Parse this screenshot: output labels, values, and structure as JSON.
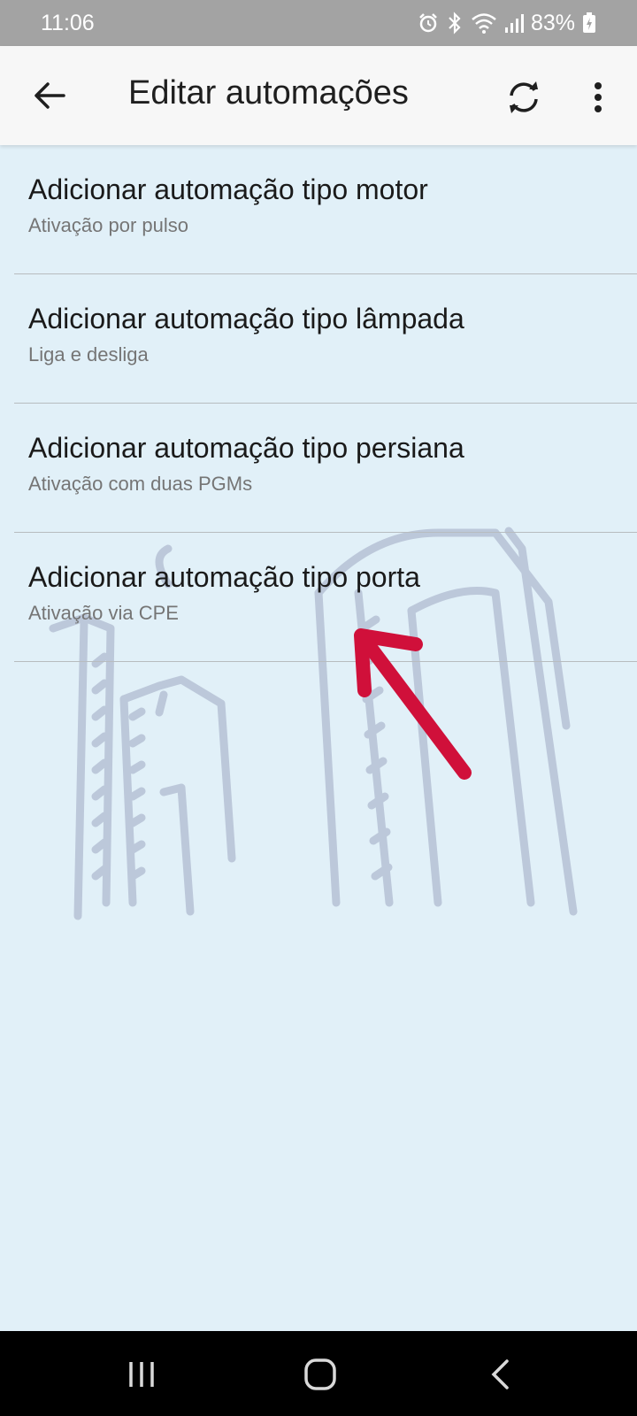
{
  "status_bar": {
    "time": "11:06",
    "battery_percent": "83%",
    "icons": [
      "alarm-icon",
      "bluetooth-icon",
      "wifi-icon",
      "signal-icon",
      "battery-charging-icon"
    ]
  },
  "app_bar": {
    "title": "Editar automações",
    "icons": [
      "back-arrow-icon",
      "refresh-icon",
      "more-vert-icon"
    ]
  },
  "items": [
    {
      "title": "Adicionar automação tipo motor",
      "subtitle": "Ativação por pulso"
    },
    {
      "title": "Adicionar automação tipo lâmpada",
      "subtitle": "Liga e desliga"
    },
    {
      "title": "Adicionar automação tipo persiana",
      "subtitle": "Ativação com duas PGMs"
    },
    {
      "title": "Adicionar automação tipo porta",
      "subtitle": "Ativação via CPE"
    }
  ],
  "nav_bar": {
    "icons": [
      "recent-apps-icon",
      "home-icon",
      "back-icon"
    ]
  },
  "colors": {
    "background": "#e1f0f8",
    "status_bar": "#a3a3a3",
    "app_bar": "#f7f7f7",
    "annotation_arrow": "#d0103a"
  }
}
